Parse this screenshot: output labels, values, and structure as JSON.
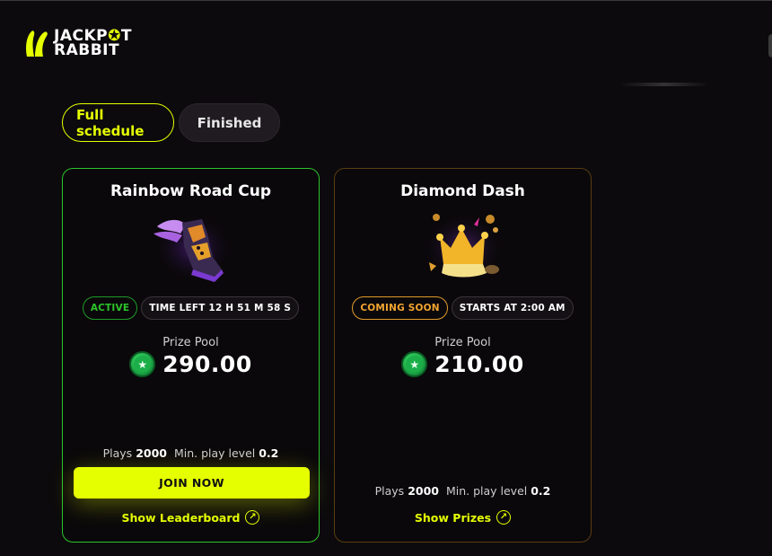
{
  "logo": {
    "line1_a": "JACKP",
    "line1_star": "✪",
    "line1_b": "T",
    "line2": "RABBIT"
  },
  "tabs": [
    {
      "label": "Full schedule",
      "active": true
    },
    {
      "label": "Finished",
      "active": false
    }
  ],
  "colors": {
    "accent": "#e5ff00",
    "active_green": "#2bc42b",
    "coming_soon_orange": "#f2a530",
    "background": "#0c0a0c"
  },
  "cards": [
    {
      "title": "Rainbow Road Cup",
      "image_icon": "winged-sneaker-icon",
      "status_badge": "ACTIVE",
      "info_badge": "TIME LEFT 12 H 51 M 58 S",
      "prize_label": "Prize Pool",
      "prize_icon": "star-coin-icon",
      "prize_value": "290.00",
      "plays_label": "Plays",
      "plays_value": "2000",
      "min_level_label": "Min. play level",
      "min_level_value": "0.2",
      "cta_label": "JOIN NOW",
      "link_label": "Show Leaderboard",
      "link_icon": "arrow-up-right-circle-icon"
    },
    {
      "title": "Diamond Dash",
      "image_icon": "golden-crown-icon",
      "status_badge": "COMING SOON",
      "info_badge": "STARTS AT 2:00 AM",
      "prize_label": "Prize Pool",
      "prize_icon": "star-coin-icon",
      "prize_value": "210.00",
      "plays_label": "Plays",
      "plays_value": "2000",
      "min_level_label": "Min. play level",
      "min_level_value": "0.2",
      "link_label": "Show Prizes",
      "link_icon": "arrow-up-right-circle-icon"
    }
  ]
}
